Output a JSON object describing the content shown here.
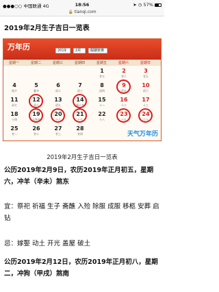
{
  "status_bar": {
    "carrier": "中国联通",
    "network": "4G",
    "time": "18:56",
    "battery": "57%",
    "battery_level_percent": 57
  },
  "url_bar": {
    "domain": "tianqi.com"
  },
  "page_heading": "2019年2月生子吉日一览表",
  "calendar": {
    "logo": "万年历",
    "controls": [
      "2019",
      "2月",
      "假期安排"
    ],
    "weekdays": [
      "星期一",
      "星期二",
      "星期三",
      "星期四",
      "星期五",
      "星期六",
      "星期日"
    ],
    "rows": [
      [
        {
          "d": "",
          "s": ""
        },
        {
          "d": "",
          "s": ""
        },
        {
          "d": "",
          "s": ""
        },
        {
          "d": "",
          "s": ""
        },
        {
          "d": "1",
          "s": "廿七"
        },
        {
          "d": "2",
          "s": "廿八"
        },
        {
          "d": "3",
          "s": "廿九"
        }
      ],
      [
        {
          "d": "4",
          "s": "除夕"
        },
        {
          "d": "5",
          "s": "春节"
        },
        {
          "d": "6",
          "s": "初二"
        },
        {
          "d": "7",
          "s": "初三"
        },
        {
          "d": "8",
          "s": "初四"
        },
        {
          "d": "9",
          "s": "初五"
        },
        {
          "d": "10",
          "s": "初六"
        }
      ],
      [
        {
          "d": "11",
          "s": "初七"
        },
        {
          "d": "12",
          "s": "初八"
        },
        {
          "d": "13",
          "s": "初九"
        },
        {
          "d": "14",
          "s": "情人节"
        },
        {
          "d": "15",
          "s": "十一"
        },
        {
          "d": "16",
          "s": "十二"
        },
        {
          "d": "17",
          "s": "十三"
        }
      ],
      [
        {
          "d": "18",
          "s": "十四"
        },
        {
          "d": "19",
          "s": "元宵节"
        },
        {
          "d": "20",
          "s": "十六"
        },
        {
          "d": "21",
          "s": "十七"
        },
        {
          "d": "22",
          "s": "十八"
        },
        {
          "d": "23",
          "s": "十九"
        },
        {
          "d": "24",
          "s": "二十"
        }
      ],
      [
        {
          "d": "25",
          "s": "廿一"
        },
        {
          "d": "26",
          "s": "廿二"
        },
        {
          "d": "27",
          "s": "廿三"
        },
        {
          "d": "28",
          "s": "廿四"
        },
        {
          "d": "",
          "s": ""
        },
        {
          "d": "",
          "s": ""
        },
        {
          "d": "",
          "s": ""
        }
      ]
    ],
    "circled_days": [
      "9",
      "12",
      "14",
      "19",
      "20",
      "21",
      "23",
      "24"
    ],
    "brand": "天气万年历",
    "accent_color": "#e01818"
  },
  "caption": "2019年2月生子吉日一览表",
  "entries": [
    {
      "text": "公历2019年2月9日，农历2019年正月初五，星期六，冲羊（辛未）煞东"
    },
    {
      "text": "宜：祭祀 祈福 生子 斋醮 入殓 除服 成服 移柩 安葬 启钻"
    },
    {
      "text": "忌：嫁娶 动土 开光 盖屋 破土"
    },
    {
      "text": "公历2019年2月12日，农历2019年正月初八，星期二，冲狗（甲戌）煞南"
    }
  ]
}
